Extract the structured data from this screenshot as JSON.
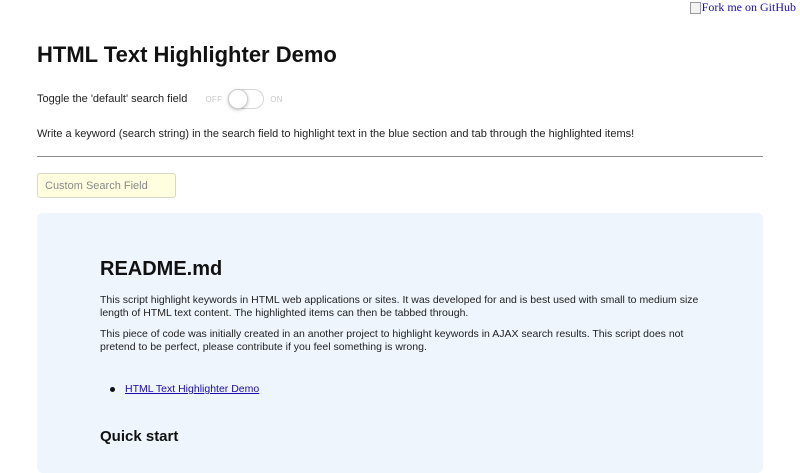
{
  "fork_ribbon": {
    "text": "Fork me on GitHub"
  },
  "header": {
    "title": "HTML Text Highlighter Demo"
  },
  "toggle": {
    "label": "Toggle the 'default' search field",
    "off_text": "OFF",
    "on_text": "ON",
    "state": "off"
  },
  "instructions": "Write a keyword (search string) in the search field to highlight text in the blue section and tab through the highlighted items!",
  "search": {
    "placeholder": "Custom Search Field",
    "value": ""
  },
  "readme": {
    "heading": "README.md",
    "paragraph1": "This script highlight keywords in HTML web applications or sites. It was developed for and is best used with small to medium size length of HTML text content. The highlighted items can then be tabbed through.",
    "paragraph2": "This piece of code was initially created in an another project to highlight keywords in AJAX search results. This script does not pretend to be perfect, please contribute if you feel something is wrong.",
    "toc": [
      {
        "label": "HTML Text Highlighter Demo"
      }
    ],
    "subheading": "Quick start"
  },
  "colors": {
    "panel_background": "#eef5fd",
    "search_background": "#ffffe0",
    "link": "#1a0dab"
  }
}
